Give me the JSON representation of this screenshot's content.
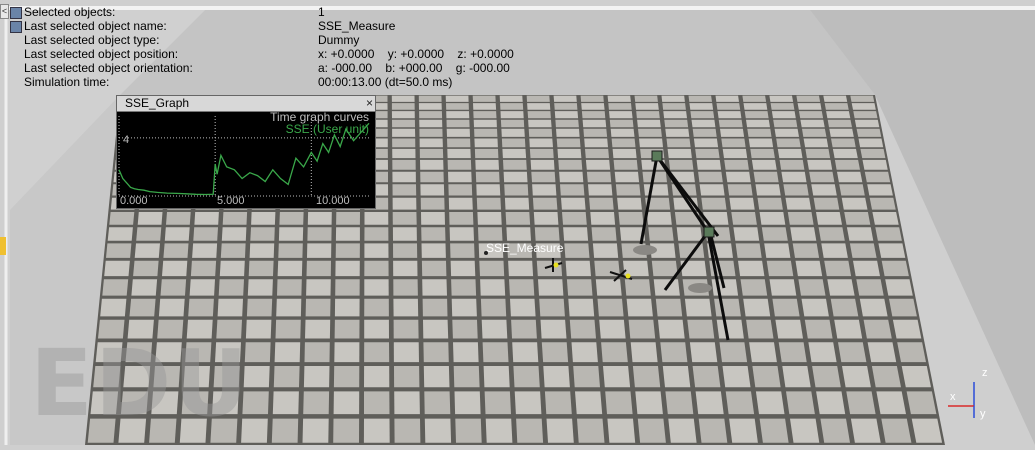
{
  "info": {
    "rows": [
      {
        "label": "Selected objects:",
        "value": "1"
      },
      {
        "label": "Last selected object name:",
        "value": "SSE_Measure"
      },
      {
        "label": "Last selected object type:",
        "value": "Dummy"
      },
      {
        "label": "Last selected object position:",
        "value": "x: +0.0000    y: +0.0000    z: +0.0000"
      },
      {
        "label": "Last selected object orientation:",
        "value": "a: -000.00    b: +000.00    g: -000.00"
      },
      {
        "label": "Simulation time:",
        "value": "00:00:13.00 (dt=50.0 ms)"
      }
    ],
    "collapse_glyph": "<"
  },
  "graph": {
    "title": "SSE_Graph",
    "close_glyph": "×",
    "legend_title": "Time graph curves",
    "legend_series": "SSE (User unit)",
    "ytick": "4",
    "xticks": [
      "0.000",
      "5.000",
      "10.000"
    ],
    "colors": {
      "curve": "#3aa84a",
      "grid": "#bdbdbd",
      "text": "#bdbdbd",
      "legend_series": "#3aa84a"
    },
    "chart_data": {
      "type": "line",
      "x": [
        0,
        0.2,
        0.4,
        0.6,
        0.8,
        1.0,
        1.3,
        1.6,
        2.0,
        2.5,
        3.0,
        3.5,
        4.0,
        4.5,
        4.9,
        5.0,
        5.1,
        5.3,
        5.6,
        6.0,
        6.4,
        6.8,
        7.2,
        7.6,
        8.0,
        8.4,
        8.8,
        9.2,
        9.6,
        10.0,
        10.3,
        10.6,
        10.9,
        11.2,
        11.5,
        11.8,
        12.2,
        12.6,
        13.0
      ],
      "y": [
        1.8,
        1.2,
        0.9,
        0.6,
        0.5,
        0.45,
        0.4,
        0.3,
        0.25,
        0.2,
        0.18,
        0.15,
        0.12,
        0.1,
        0.12,
        2.2,
        1.5,
        2.8,
        2.0,
        1.8,
        1.2,
        1.6,
        1.4,
        1.0,
        1.8,
        1.2,
        0.8,
        2.6,
        2.0,
        3.0,
        2.4,
        3.6,
        3.0,
        4.2,
        3.4,
        4.6,
        3.8,
        4.4,
        5.0
      ],
      "xlim": [
        0,
        13
      ],
      "ylim": [
        0,
        5.5
      ],
      "xticks": [
        0,
        5,
        10
      ],
      "yticks": [
        4
      ]
    }
  },
  "scene": {
    "object_label": "SSE_Measure",
    "watermark": "EDU",
    "axis_labels": {
      "z": "z",
      "x": "x",
      "y": "y"
    },
    "colors": {
      "floor_light": "#c8c6c1",
      "floor_dark": "#9a9893",
      "wall": "#c9c9c9",
      "wall_top": "#ececec",
      "grout": "#5f5e5a"
    }
  }
}
